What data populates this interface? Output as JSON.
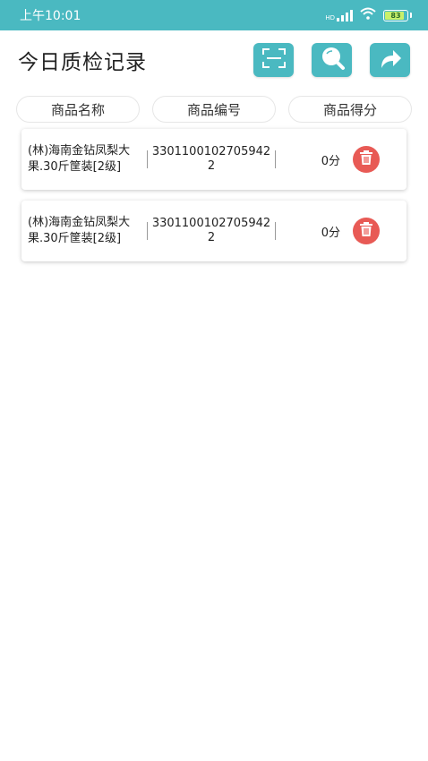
{
  "status_bar": {
    "time": "上午10:01",
    "signal_label": "HD",
    "battery": "83"
  },
  "header": {
    "title": "今日质检记录",
    "buttons": [
      {
        "icon": "scan-icon"
      },
      {
        "icon": "search-icon"
      },
      {
        "icon": "share-icon"
      }
    ]
  },
  "columns": [
    "商品名称",
    "商品编号",
    "商品得分"
  ],
  "records": [
    {
      "name": "(林)海南金钻凤梨大果.30斤筐装[2级]",
      "code": "33011001027059422",
      "score": "0分"
    },
    {
      "name": "(林)海南金钻凤梨大果.30斤筐装[2级]",
      "code": "33011001027059422",
      "score": "0分"
    }
  ],
  "colors": {
    "accent": "#4ab9c1",
    "delete": "#e85a55"
  }
}
